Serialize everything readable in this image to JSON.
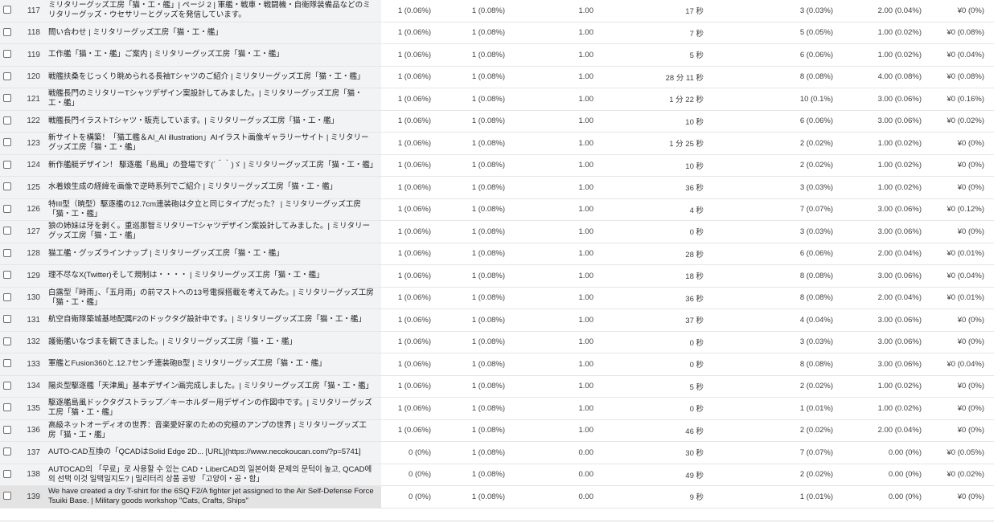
{
  "rows": [
    {
      "n": "117",
      "title": "ミリタリーグッズ工房「猫・工・艦」| ページ 2 | 軍艦・戦車・戦闘機・自衛隊装備品などのミリタリーグッズ・ウセサリーとグッズを発信しています。",
      "sessions": "1 (0.06%)",
      "users": "1 (0.08%)",
      "pv": "1.00",
      "duration": "17 秒",
      "events": "3 (0.03%)",
      "keyev": "2.00 (0.04%)",
      "revenue": "¥0 (0%)"
    },
    {
      "n": "118",
      "title": "問い合わせ | ミリタリーグッズ工房「猫・工・艦」",
      "sessions": "1 (0.06%)",
      "users": "1 (0.08%)",
      "pv": "1.00",
      "duration": "7 秒",
      "events": "5 (0.05%)",
      "keyev": "1.00 (0.02%)",
      "revenue": "¥0 (0.08%)"
    },
    {
      "n": "119",
      "title": "工作艦「猫・工・艦」ご案内 | ミリタリーグッズ工房「猫・工・艦」",
      "sessions": "1 (0.06%)",
      "users": "1 (0.08%)",
      "pv": "1.00",
      "duration": "5 秒",
      "events": "6 (0.06%)",
      "keyev": "1.00 (0.02%)",
      "revenue": "¥0 (0.04%)"
    },
    {
      "n": "120",
      "title": "戦艦扶桑をじっくり眺められる長袖Tシャツのご紹介 | ミリタリーグッズ工房「猫・工・艦」",
      "sessions": "1 (0.06%)",
      "users": "1 (0.08%)",
      "pv": "1.00",
      "duration": "28 分 11 秒",
      "events": "8 (0.08%)",
      "keyev": "4.00 (0.08%)",
      "revenue": "¥0 (0.08%)"
    },
    {
      "n": "121",
      "title": "戦艦長門のミリタリーTシャツデザイン案設計してみました。| ミリタリーグッズ工房「猫・工・艦」",
      "sessions": "1 (0.06%)",
      "users": "1 (0.08%)",
      "pv": "1.00",
      "duration": "1 分 22 秒",
      "events": "10 (0.1%)",
      "keyev": "3.00 (0.06%)",
      "revenue": "¥0 (0.16%)"
    },
    {
      "n": "122",
      "title": "戦艦長門イラストTシャツ・販売しています。| ミリタリーグッズ工房「猫・工・艦」",
      "sessions": "1 (0.06%)",
      "users": "1 (0.08%)",
      "pv": "1.00",
      "duration": "10 秒",
      "events": "6 (0.06%)",
      "keyev": "3.00 (0.06%)",
      "revenue": "¥0 (0.02%)"
    },
    {
      "n": "123",
      "title": "新サイトを構築！「猫工艦＆AI_AI illustration」AIイラスト画像ギャラリーサイト | ミリタリーグッズ工房「猫・工・艦」",
      "sessions": "1 (0.06%)",
      "users": "1 (0.08%)",
      "pv": "1.00",
      "duration": "1 分 25 秒",
      "events": "2 (0.02%)",
      "keyev": "1.00 (0.02%)",
      "revenue": "¥0 (0%)"
    },
    {
      "n": "124",
      "title": "新作艦艇デザイン！ 駆逐艦「島風」の登場です(´＾｀)ゞ | ミリタリーグッズ工房「猫・工・艦」",
      "sessions": "1 (0.06%)",
      "users": "1 (0.08%)",
      "pv": "1.00",
      "duration": "10 秒",
      "events": "2 (0.02%)",
      "keyev": "1.00 (0.02%)",
      "revenue": "¥0 (0%)"
    },
    {
      "n": "125",
      "title": "水着娘生成の経緯を画像で逆時系列でご紹介 | ミリタリーグッズ工房「猫・工・艦」",
      "sessions": "1 (0.06%)",
      "users": "1 (0.08%)",
      "pv": "1.00",
      "duration": "36 秒",
      "events": "3 (0.03%)",
      "keyev": "1.00 (0.02%)",
      "revenue": "¥0 (0%)"
    },
    {
      "n": "126",
      "title": "特III型（暁型）駆逐艦の12.7cm連装砲は夕立と同じタイプだった？ | ミリタリーグッズ工房「猫・工・艦」",
      "sessions": "1 (0.06%)",
      "users": "1 (0.08%)",
      "pv": "1.00",
      "duration": "4 秒",
      "events": "7 (0.07%)",
      "keyev": "3.00 (0.06%)",
      "revenue": "¥0 (0.12%)"
    },
    {
      "n": "127",
      "title": "狼の姉妹は牙を剥く。重巡那智ミリタリーTシャツデザイン案設計してみました。| ミリタリーグッズ工房「猫・工・艦」",
      "sessions": "1 (0.06%)",
      "users": "1 (0.08%)",
      "pv": "1.00",
      "duration": "0 秒",
      "events": "3 (0.03%)",
      "keyev": "3.00 (0.06%)",
      "revenue": "¥0 (0%)"
    },
    {
      "n": "128",
      "title": "猫工艦・グッズラインナップ | ミリタリーグッズ工房「猫・工・艦」",
      "sessions": "1 (0.06%)",
      "users": "1 (0.08%)",
      "pv": "1.00",
      "duration": "28 秒",
      "events": "6 (0.06%)",
      "keyev": "2.00 (0.04%)",
      "revenue": "¥0 (0.01%)"
    },
    {
      "n": "129",
      "title": "理不尽なX(Twitter)そして規制は・・・・ | ミリタリーグッズ工房「猫・工・艦」",
      "sessions": "1 (0.06%)",
      "users": "1 (0.08%)",
      "pv": "1.00",
      "duration": "18 秒",
      "events": "8 (0.08%)",
      "keyev": "3.00 (0.06%)",
      "revenue": "¥0 (0.04%)"
    },
    {
      "n": "130",
      "title": "白露型「時雨」、「五月雨」の前マストへの13号電探搭載を考えてみた。| ミリタリーグッズ工房「猫・工・艦」",
      "sessions": "1 (0.06%)",
      "users": "1 (0.08%)",
      "pv": "1.00",
      "duration": "36 秒",
      "events": "8 (0.08%)",
      "keyev": "2.00 (0.04%)",
      "revenue": "¥0 (0.01%)"
    },
    {
      "n": "131",
      "title": "航空自衛隊築城基地配属F2のドックタグ設計中です。| ミリタリーグッズ工房「猫・工・艦」",
      "sessions": "1 (0.06%)",
      "users": "1 (0.08%)",
      "pv": "1.00",
      "duration": "37 秒",
      "events": "4 (0.04%)",
      "keyev": "3.00 (0.06%)",
      "revenue": "¥0 (0%)"
    },
    {
      "n": "132",
      "title": "護衛艦いなづまを観てきました。| ミリタリーグッズ工房「猫・工・艦」",
      "sessions": "1 (0.06%)",
      "users": "1 (0.08%)",
      "pv": "1.00",
      "duration": "0 秒",
      "events": "3 (0.03%)",
      "keyev": "3.00 (0.06%)",
      "revenue": "¥0 (0%)"
    },
    {
      "n": "133",
      "title": "軍艦とFusion360と.12.7センチ連装砲B型 | ミリタリーグッズ工房「猫・工・艦」",
      "sessions": "1 (0.06%)",
      "users": "1 (0.08%)",
      "pv": "1.00",
      "duration": "0 秒",
      "events": "8 (0.08%)",
      "keyev": "3.00 (0.06%)",
      "revenue": "¥0 (0.04%)"
    },
    {
      "n": "134",
      "title": "陽炎型駆逐艦「天津風」基本デザイン画完成しました。| ミリタリーグッズ工房「猫・工・艦」",
      "sessions": "1 (0.06%)",
      "users": "1 (0.08%)",
      "pv": "1.00",
      "duration": "5 秒",
      "events": "2 (0.02%)",
      "keyev": "1.00 (0.02%)",
      "revenue": "¥0 (0%)"
    },
    {
      "n": "135",
      "title": "駆逐艦島風ドックタグストラップ／キーホルダー用デザインの作図中です。| ミリタリーグッズ工房「猫・工・艦」",
      "sessions": "1 (0.06%)",
      "users": "1 (0.08%)",
      "pv": "1.00",
      "duration": "0 秒",
      "events": "1 (0.01%)",
      "keyev": "1.00 (0.02%)",
      "revenue": "¥0 (0%)"
    },
    {
      "n": "136",
      "title": "高級ネットオーディオの世界：音楽愛好家のための究極のアンプの世界 | ミリタリーグッズ工房「猫・工・艦」",
      "sessions": "1 (0.06%)",
      "users": "1 (0.08%)",
      "pv": "1.00",
      "duration": "46 秒",
      "events": "2 (0.02%)",
      "keyev": "2.00 (0.04%)",
      "revenue": "¥0 (0%)"
    },
    {
      "n": "137",
      "title": "AUTO-CAD互換の「QCADはSolid Edge 2D... [URL](https://www.necokoucan.com/?p=5741]",
      "sessions": "0 (0%)",
      "users": "1 (0.08%)",
      "pv": "0.00",
      "duration": "30 秒",
      "events": "7 (0.07%)",
      "keyev": "0.00 (0%)",
      "revenue": "¥0 (0.05%)"
    },
    {
      "n": "138",
      "title": "AUTOCAD의 「무료」로 사용할 수 있는 CAD・LiberCAD의 일본어화 문제의 문턱이 높고, QCAD에의 선택 이것 일택일지도? | 밀리터리 상품 공방 「고양이・공・함」",
      "sessions": "0 (0%)",
      "users": "1 (0.08%)",
      "pv": "0.00",
      "duration": "49 秒",
      "events": "2 (0.02%)",
      "keyev": "0.00 (0%)",
      "revenue": "¥0 (0.02%)"
    },
    {
      "n": "139",
      "title": "We have created a dry T-shirt for the 6SQ F2/A fighter jet assigned to the Air Self-Defense Force Tsuiki Base. | Military goods workshop \"Cats, Crafts, Ships\"",
      "sessions": "0 (0%)",
      "users": "1 (0.08%)",
      "pv": "0.00",
      "duration": "9 秒",
      "events": "1 (0.01%)",
      "keyev": "0.00 (0%)",
      "revenue": "¥0 (0%)"
    }
  ]
}
